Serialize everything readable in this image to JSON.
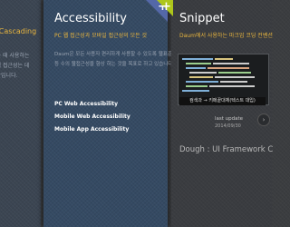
{
  "left_card": {
    "title": "& Cascading",
    "desc_lines": [
      "만들 때 사용하는",
      "봄핵 접근성는 데",
      "약관입니다."
    ]
  },
  "accessibility_card": {
    "title": "Accessibility",
    "subtitle": "PC 웹 접근성과 모바일 접근성의 모든 것",
    "desc_lines": [
      "Daum은 모든 사용자 편리하게 사용할 수 있도록 웹표준",
      "등 수의 웹접근성을 향상 하는 것을 목표로 하고 있습니다."
    ],
    "links": [
      "PC Web Accessibility",
      "Mobile Web Accessibility",
      "Mobile App Accessibility"
    ],
    "accent_color": "#5468a8"
  },
  "snippet_card": {
    "title": "Snippet",
    "subtitle": "Daum에서 사용하는 마크업 코딩 컨벤션",
    "code_caption": "컴색과 → 키메끝대체(텍스트 대입)",
    "last_update_label": "last update",
    "last_update_date": "2014/09/30",
    "accent_color": "#aec61b"
  },
  "framework_title": "Dough : UI Framework C",
  "icons": {
    "plus_mid": "plus-icon",
    "plus_right": "plus-icon",
    "arrow": "chevron-right-icon"
  }
}
